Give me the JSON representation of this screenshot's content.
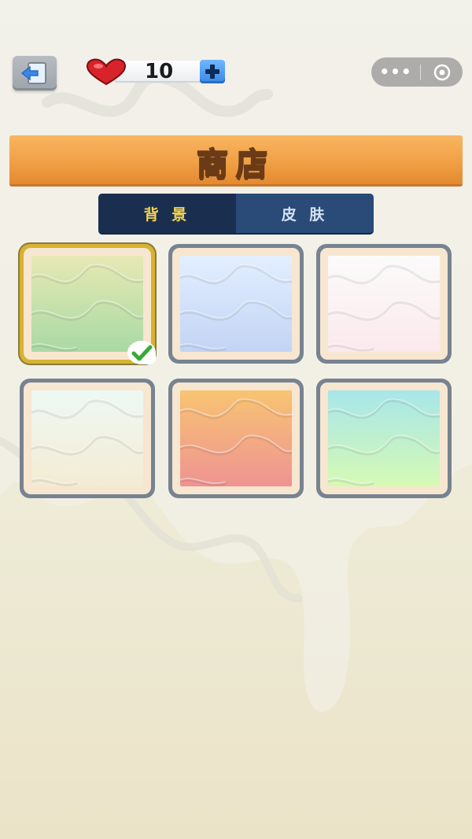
{
  "hud": {
    "hearts_count": "10",
    "capsule_more": "•••"
  },
  "title": "商店",
  "tabs": [
    {
      "label": "背 景",
      "active": true
    },
    {
      "label": "皮 肤",
      "active": false
    }
  ],
  "items": [
    {
      "colors": [
        "#e7e9b4",
        "#a9d9a4"
      ],
      "selected": true
    },
    {
      "colors": [
        "#e2efff",
        "#c2d4f5"
      ],
      "selected": false
    },
    {
      "colors": [
        "#fbfbfb",
        "#fbe9ec"
      ],
      "selected": false
    },
    {
      "colors": [
        "#eef8f4",
        "#f3ecd4"
      ],
      "selected": false
    },
    {
      "colors": [
        "#f8c472",
        "#ee9393"
      ],
      "selected": false
    },
    {
      "colors": [
        "#a7e6ea",
        "#d6fab4"
      ],
      "selected": false
    }
  ],
  "colors": {
    "banner": "#f1a047",
    "tab_bar": "#1e3a61",
    "tab_active_text": "#f4d34f",
    "item_border": "#778391",
    "item_selected_border": "#d7b331"
  }
}
